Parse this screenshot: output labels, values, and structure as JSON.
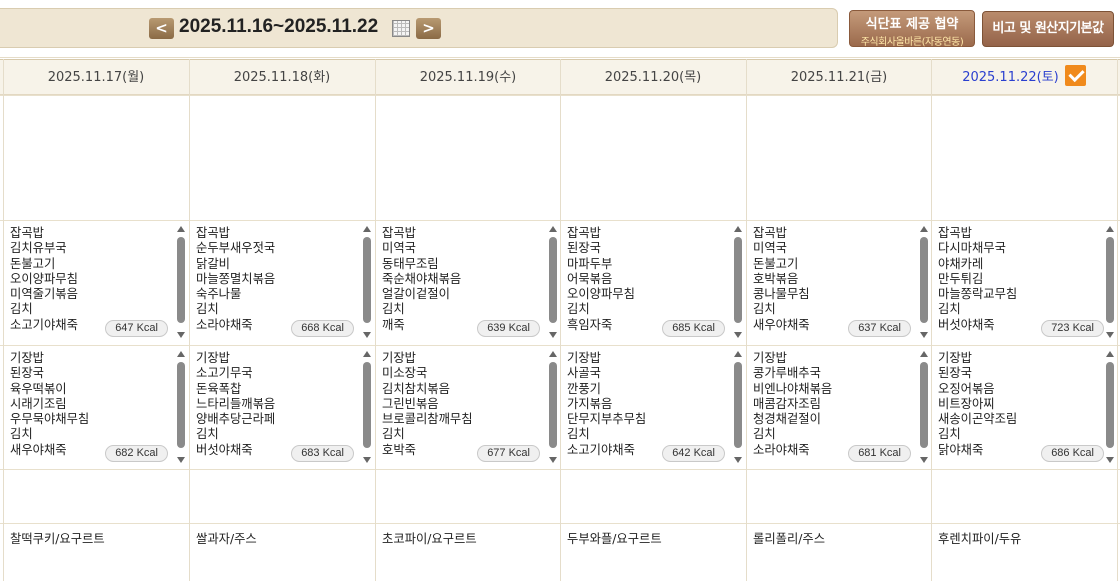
{
  "nav": {
    "prev_glyph": "<",
    "next_glyph": ">",
    "range": "2025.11.16~2025.11.22",
    "calendar_icon": "calendar-icon"
  },
  "buttons": {
    "contract_title": "식단표 제공 협약",
    "contract_sub": "주식회사올바른(자동연동)",
    "notes": "비고 및 원산지기본값"
  },
  "colors": {
    "accent_check": "#f08a1c",
    "saturday": "#2a3fcf",
    "bar_bg": "#efe6d3"
  },
  "days": [
    {
      "date": "2025.11.17(월)",
      "lunch": [
        "잡곡밥",
        "김치유부국",
        "돈불고기",
        "오이양파무침",
        "미역줄기볶음",
        "김치",
        "소고기야채죽"
      ],
      "lunch_kcal": "647 Kcal",
      "dinner": [
        "기장밥",
        "된장국",
        "육우떡볶이",
        "시래기조림",
        "우무묵야채무침",
        "김치",
        "새우야채죽"
      ],
      "dinner_kcal": "682 Kcal",
      "snack": "찰떡쿠키/요구르트"
    },
    {
      "date": "2025.11.18(화)",
      "lunch": [
        "잡곡밥",
        "순두부새우젓국",
        "닭갈비",
        "마늘쫑멸치볶음",
        "숙주나물",
        "김치",
        "소라야채죽"
      ],
      "lunch_kcal": "668 Kcal",
      "dinner": [
        "기장밥",
        "소고기무국",
        "돈육폭찹",
        "느타리들깨볶음",
        "양배추당근라페",
        "김치",
        "버섯야채죽"
      ],
      "dinner_kcal": "683 Kcal",
      "snack": "쌀과자/주스"
    },
    {
      "date": "2025.11.19(수)",
      "lunch": [
        "잡곡밥",
        "미역국",
        "동태무조림",
        "죽순채야채볶음",
        "얼갈이겉절이",
        "김치",
        "깨죽"
      ],
      "lunch_kcal": "639 Kcal",
      "dinner": [
        "기장밥",
        "미소장국",
        "김치참치볶음",
        "그린빈볶음",
        "브로콜리참깨무침",
        "김치",
        "호박죽"
      ],
      "dinner_kcal": "677 Kcal",
      "snack": "초코파이/요구르트"
    },
    {
      "date": "2025.11.20(목)",
      "lunch": [
        "잡곡밥",
        "된장국",
        "마파두부",
        "어묵볶음",
        "오이양파무침",
        "김치",
        "흑임자죽"
      ],
      "lunch_kcal": "685 Kcal",
      "dinner": [
        "기장밥",
        "사골국",
        "깐풍기",
        "가지볶음",
        "단무지부추무침",
        "김치",
        "소고기야채죽"
      ],
      "dinner_kcal": "642 Kcal",
      "snack": "두부와플/요구르트"
    },
    {
      "date": "2025.11.21(금)",
      "lunch": [
        "잡곡밥",
        "미역국",
        "돈불고기",
        "호박볶음",
        "콩나물무침",
        "김치",
        "새우야채죽"
      ],
      "lunch_kcal": "637 Kcal",
      "dinner": [
        "기장밥",
        "콩가루배추국",
        "비엔나야채볶음",
        "매콤감자조림",
        "청경채겉절이",
        "김치",
        "소라야채죽"
      ],
      "dinner_kcal": "681 Kcal",
      "snack": "롤리폴리/주스"
    },
    {
      "date": "2025.11.22(토)",
      "lunch": [
        "잡곡밥",
        "다시마채무국",
        "야채카레",
        "만두튀김",
        "마늘쫑락교무침",
        "김치",
        "버섯야채죽"
      ],
      "lunch_kcal": "723 Kcal",
      "dinner": [
        "기장밥",
        "된장국",
        "오징어볶음",
        "비트장아찌",
        "새송이곤약조림",
        "김치",
        "닭야채죽"
      ],
      "dinner_kcal": "686 Kcal",
      "snack": "후렌치파이/두유"
    }
  ]
}
